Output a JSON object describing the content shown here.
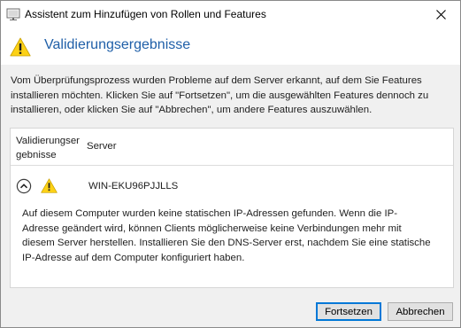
{
  "window": {
    "title": "Assistent zum Hinzufügen von Rollen und Features"
  },
  "header": {
    "title": "Validierungsergebnisse"
  },
  "intro_text": "Vom Überprüfungsprozess wurden Probleme auf dem Server erkannt, auf dem Sie Features installieren möchten. Klicken Sie auf \"Fortsetzen\", um die ausgewählten Features dennoch zu installieren, oder klicken Sie auf \"Abbrechen\", um andere Features auszuwählen.",
  "table": {
    "columns": [
      "Validierungsergebnisse",
      "Server"
    ],
    "rows": [
      {
        "status_icon": "warning-icon",
        "server": "WIN-EKU96PJJLLS",
        "expanded": true,
        "message": "Auf diesem Computer wurden keine statischen IP-Adressen gefunden. Wenn die IP-Adresse geändert wird, können Clients möglicherweise keine Verbindungen mehr mit diesem Server herstellen. Installieren Sie den DNS-Server erst, nachdem Sie eine statische IP-Adresse auf dem Computer konfiguriert haben."
      }
    ]
  },
  "buttons": {
    "continue": "Fortsetzen",
    "cancel": "Abbrechen"
  },
  "colors": {
    "title_blue": "#1f5fa8",
    "warning_yellow": "#fcd116",
    "focus_blue": "#0078d7"
  }
}
